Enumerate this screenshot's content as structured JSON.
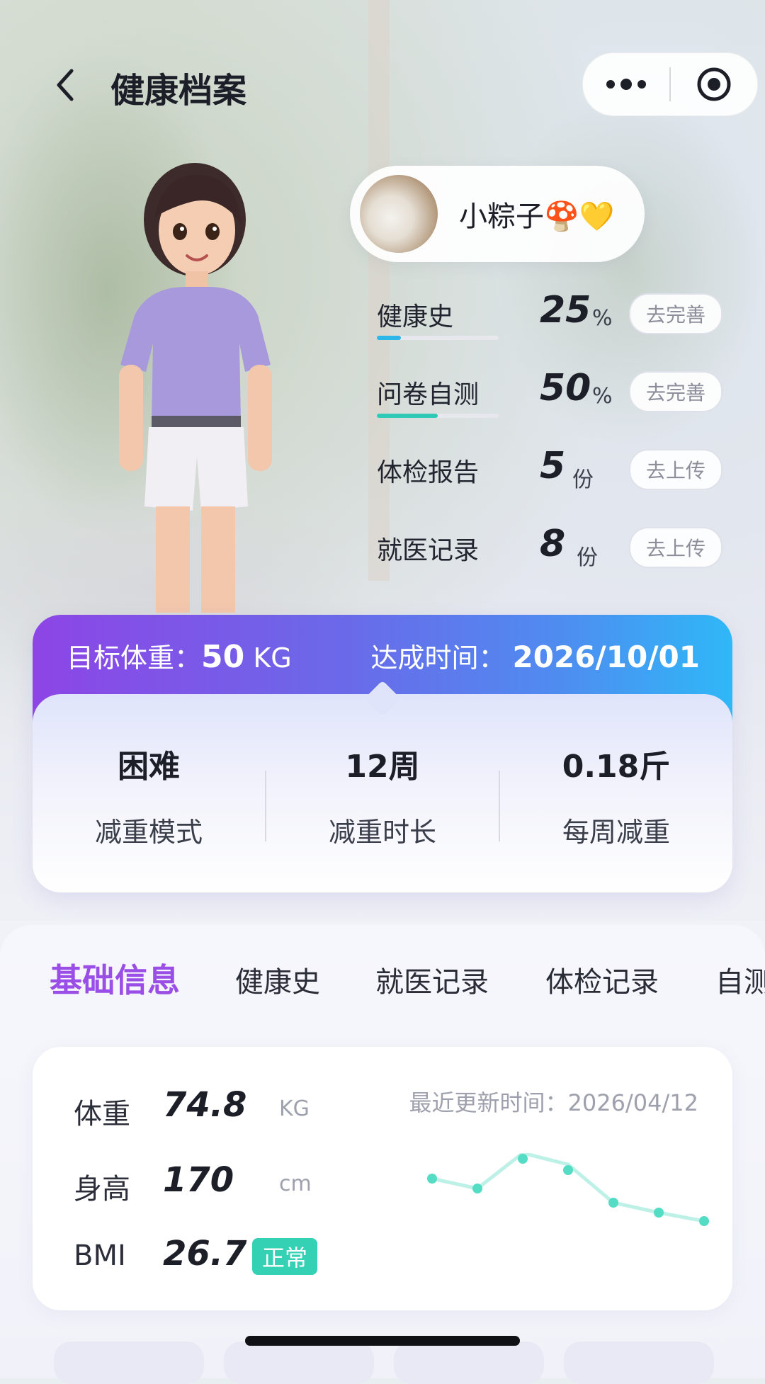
{
  "header": {
    "title": "健康档案",
    "back_icon": "chevron-left-icon",
    "more_icon": "more-dots-icon",
    "target_icon": "target-icon"
  },
  "profile": {
    "name": "小粽子🍄💛"
  },
  "stats": [
    {
      "label": "健康史",
      "value": "25",
      "unit": "%",
      "action": "去完善",
      "progress": 0.2,
      "bar_color": "#2bb7e8"
    },
    {
      "label": "问卷自测",
      "value": "50",
      "unit": "%",
      "action": "去完善",
      "progress": 0.5,
      "bar_color": "#30c9b8"
    },
    {
      "label": "体检报告",
      "value": "5",
      "unit": "份",
      "action": "去上传"
    },
    {
      "label": "就医记录",
      "value": "8",
      "unit": "份",
      "action": "去上传"
    }
  ],
  "goal": {
    "target_label": "目标体重：",
    "target_value": "50",
    "target_unit": "KG",
    "date_label": "达成时间：",
    "date_value": "2026/10/01",
    "items": [
      {
        "value": "困难",
        "label": "减重模式"
      },
      {
        "value": "12周",
        "label": "减重时长"
      },
      {
        "value": "0.18斤",
        "label": "每周减重"
      }
    ]
  },
  "tabs": [
    {
      "label": "基础信息",
      "active": true
    },
    {
      "label": "健康史",
      "active": false
    },
    {
      "label": "就医记录",
      "active": false
    },
    {
      "label": "体检记录",
      "active": false
    },
    {
      "label": "自测",
      "active": false
    }
  ],
  "metrics": {
    "updated": "最近更新时间：2026/04/12",
    "weight": {
      "label": "体重",
      "value": "74.8",
      "unit": "KG"
    },
    "height": {
      "label": "身高",
      "value": "170",
      "unit": "cm"
    },
    "bmi": {
      "label": "BMI",
      "value": "26.7",
      "badge": "正常"
    },
    "trend_color": "#8ee6d8"
  },
  "colors": {
    "accent_purple": "#9a4ee6",
    "gradient_start": "#8d45e6",
    "gradient_end": "#2fb8f7",
    "badge_green": "#34d1b5"
  }
}
